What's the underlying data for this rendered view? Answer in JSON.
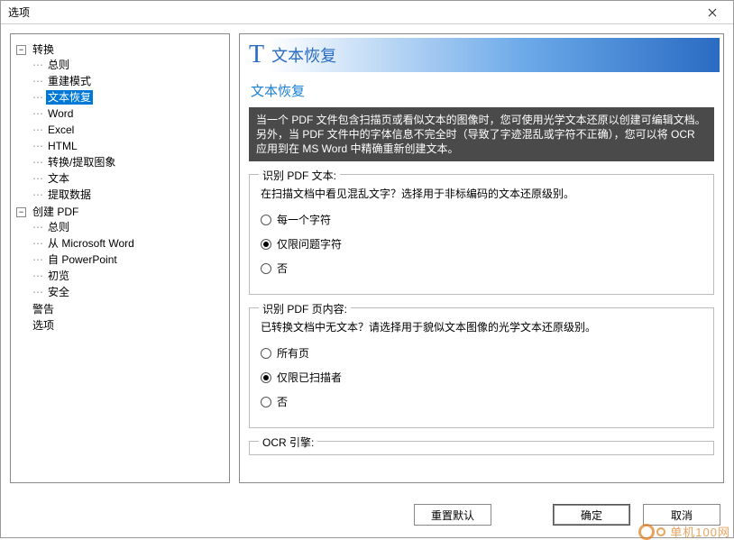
{
  "window": {
    "title": "选项"
  },
  "tree": {
    "convert": {
      "label": "转换",
      "expanded": true,
      "items": [
        {
          "key": "general",
          "label": "总则"
        },
        {
          "key": "rebuild",
          "label": "重建模式"
        },
        {
          "key": "textrecovery",
          "label": "文本恢复",
          "selected": true
        },
        {
          "key": "word",
          "label": "Word"
        },
        {
          "key": "excel",
          "label": "Excel"
        },
        {
          "key": "html",
          "label": "HTML"
        },
        {
          "key": "extractimg",
          "label": "转换/提取图象"
        },
        {
          "key": "text",
          "label": "文本"
        },
        {
          "key": "extractdata",
          "label": "提取数据"
        }
      ]
    },
    "createpdf": {
      "label": "创建 PDF",
      "expanded": true,
      "items": [
        {
          "key": "general2",
          "label": "总则"
        },
        {
          "key": "fromword",
          "label": "从 Microsoft Word"
        },
        {
          "key": "frompp",
          "label": "自 PowerPoint"
        },
        {
          "key": "preview",
          "label": "初览"
        },
        {
          "key": "security",
          "label": "安全"
        }
      ]
    },
    "warn": {
      "label": "警告"
    },
    "options": {
      "label": "选项"
    }
  },
  "pane": {
    "header": "文本恢复",
    "subtitle": "文本恢复",
    "description": "当一个 PDF 文件包含扫描页或看似文本的图像时，您可使用光学文本还原以创建可编辑文档。另外，当 PDF 文件中的字体信息不完全时（导致了字迹混乱或字符不正确），您可以将 OCR 应用到在 MS Word 中精确重新创建文本。",
    "group1": {
      "legend": "识别 PDF 文本:",
      "prompt": "在扫描文档中看见混乱文字？选择用于非标编码的文本还原级别。",
      "options": [
        {
          "key": "everychar",
          "label": "每一个字符",
          "checked": false
        },
        {
          "key": "problemonly",
          "label": "仅限问题字符",
          "checked": true
        },
        {
          "key": "no",
          "label": "否",
          "checked": false
        }
      ]
    },
    "group2": {
      "legend": "识别 PDF 页内容:",
      "prompt": "已转换文档中无文本？请选择用于貌似文本图像的光学文本还原级别。",
      "options": [
        {
          "key": "allpages",
          "label": "所有页",
          "checked": false
        },
        {
          "key": "scannedonly",
          "label": "仅限已扫描者",
          "checked": true
        },
        {
          "key": "no2",
          "label": "否",
          "checked": false
        }
      ]
    },
    "group3": {
      "legend": "OCR 引擎:"
    }
  },
  "buttons": {
    "reset": "重置默认",
    "ok": "确定",
    "cancel": "取消"
  },
  "watermark": {
    "text": "单机100网",
    "url": "danji100.com"
  }
}
